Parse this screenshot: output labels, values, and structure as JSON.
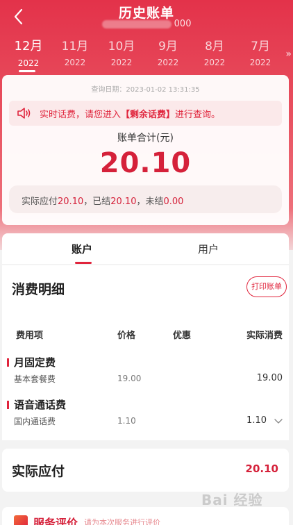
{
  "header": {
    "title": "历史账单",
    "subtitle_suffix": "000"
  },
  "months": [
    {
      "month": "12月",
      "year": "2022",
      "active": true
    },
    {
      "month": "11月",
      "year": "2022",
      "active": false
    },
    {
      "month": "10月",
      "year": "2022",
      "active": false
    },
    {
      "month": "9月",
      "year": "2022",
      "active": false
    },
    {
      "month": "8月",
      "year": "2022",
      "active": false
    },
    {
      "month": "7月",
      "year": "2022",
      "active": false
    }
  ],
  "more_icon": "»",
  "summary": {
    "query_date": "查询日期：2023-01-02 13:31:35",
    "notice_prefix": "实时话费，请您进入",
    "notice_link": "【剩余话费】",
    "notice_suffix": "进行查询。",
    "total_label": "账单合计(元)",
    "total_value": "20.10",
    "pay_label_actual": "实际应付",
    "pay_actual": "20.10",
    "pay_label_settled": "，已结",
    "pay_settled": "20.10",
    "pay_label_unsettled": "，未结",
    "pay_unsettled": "0.00"
  },
  "tabs": [
    {
      "label": "账户",
      "active": true
    },
    {
      "label": "用户",
      "active": false
    }
  ],
  "detail": {
    "title": "消费明细",
    "print_label": "打印账单",
    "columns": [
      "费用项",
      "价格",
      "优惠",
      "实际消费"
    ],
    "categories": [
      {
        "name": "月固定费",
        "item": "基本套餐费",
        "price": "19.00",
        "discount": "",
        "actual": "19.00"
      },
      {
        "name": "语音通话费",
        "item": "国内通话费",
        "price": "1.10",
        "discount": "",
        "actual": "1.10"
      }
    ]
  },
  "payable": {
    "label": "实际应付",
    "value": "20.10"
  },
  "rating": {
    "title": "服务评价",
    "subtitle": "请为本次服务进行评价"
  },
  "watermark": "Bai 经验",
  "colors": {
    "brand_red": "#e0243c",
    "hero_top": "#e3324a",
    "value_red": "#d5213a"
  },
  "icons": {
    "back": "chevron-left-icon",
    "notice": "speaker-icon",
    "expand": "chevron-down-icon"
  }
}
